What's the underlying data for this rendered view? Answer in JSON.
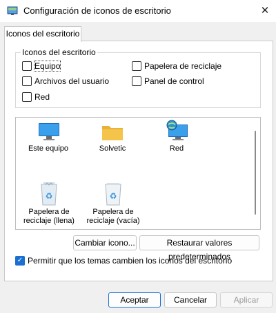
{
  "window": {
    "title": "Configuración de iconos de escritorio",
    "close_glyph": "✕"
  },
  "tab": {
    "label": "Iconos del escritorio"
  },
  "group": {
    "label": "Iconos del escritorio",
    "checkboxes": [
      {
        "label": "Equipo",
        "checked": false
      },
      {
        "label": "Papelera de reciclaje",
        "checked": false
      },
      {
        "label": "Archivos del usuario",
        "checked": false
      },
      {
        "label": "Panel de control",
        "checked": false
      },
      {
        "label": "Red",
        "checked": false
      }
    ]
  },
  "icons": [
    {
      "label": "Este equipo",
      "icon": "monitor-icon"
    },
    {
      "label": "Solvetic",
      "icon": "folder-icon"
    },
    {
      "label": "Red",
      "icon": "network-icon"
    },
    {
      "label_line1": "Papelera de",
      "label_line2": "reciclaje (llena)",
      "icon": "recycle-bin-full-icon"
    },
    {
      "label_line1": "Papelera de",
      "label_line2": "reciclaje (vacía)",
      "icon": "recycle-bin-empty-icon"
    }
  ],
  "buttons": {
    "change_icon": "Cambiar icono...",
    "restore_defaults": "Restaurar valores predeterminados",
    "accept": "Aceptar",
    "cancel": "Cancelar",
    "apply": "Aplicar"
  },
  "allow_themes": {
    "label": "Permitir que los temas cambien los iconos del escritorio",
    "checked": true
  },
  "colors": {
    "accent": "#1a6fd0",
    "folder": "#f4c44b",
    "monitor": "#2b8ee0"
  }
}
